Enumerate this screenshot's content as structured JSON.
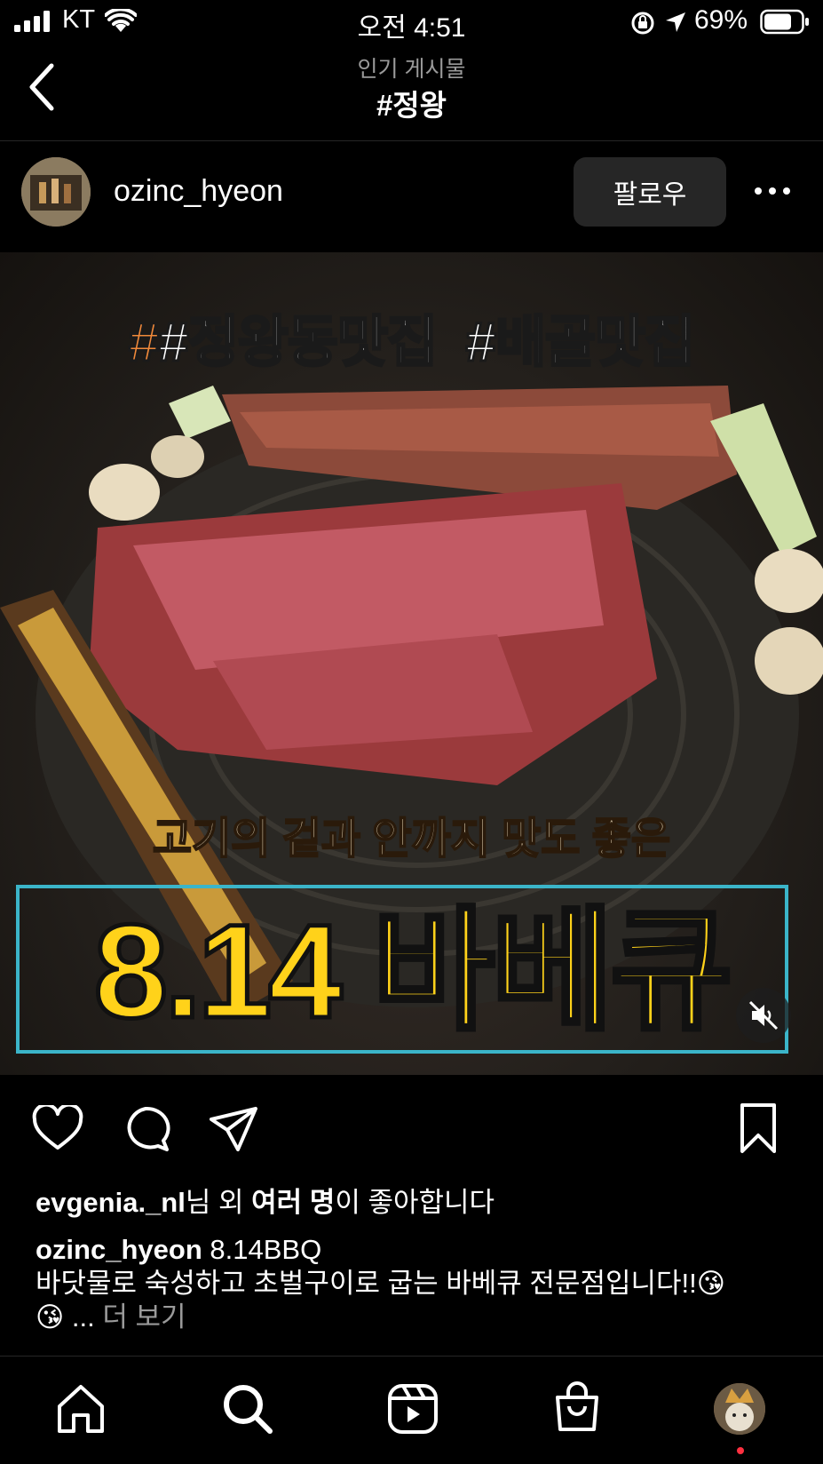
{
  "status_bar": {
    "carrier": "KT",
    "time": "오전 4:51",
    "battery_percent": "69%"
  },
  "header": {
    "subtitle": "인기 게시물",
    "title": "#정왕"
  },
  "post": {
    "username": "ozinc_hyeon",
    "follow_label": "팔로우",
    "image": {
      "tag1": "#정왕동맛집",
      "tag2": "#배골맛집",
      "subtitle": "고기의 겉과 안까지 맛도 좋은",
      "headline": "8.14 바베큐"
    },
    "likes": {
      "user": "evgenia._nl",
      "mid1": "님 외 ",
      "bold2": "여러 명",
      "tail": "이 좋아합니다"
    },
    "caption": {
      "author": "ozinc_hyeon",
      "text_line1": " 8.14BBQ",
      "text_line2": "바닷물로 숙성하고 초벌구이로 굽는 바베큐 전문점입니다!!😘",
      "text_line3": "😘 ...",
      "more_label": "더 보기"
    }
  },
  "icons": {
    "back": "chevron-left-icon",
    "like": "heart-icon",
    "comment": "comment-icon",
    "share": "paper-plane-icon",
    "save": "bookmark-icon",
    "mute": "speaker-muted-icon"
  },
  "tab_bar": {
    "items": [
      "home",
      "search",
      "reels",
      "shop",
      "profile"
    ]
  }
}
